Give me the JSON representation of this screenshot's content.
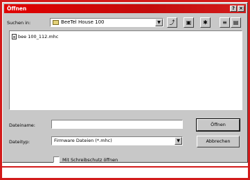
{
  "window": {
    "title": "Öffnen",
    "help_glyph": "?",
    "close_glyph": "×"
  },
  "lookin": {
    "label": "Suchen in:",
    "value": "BeeTel House 100",
    "dropdown_glyph": "▼"
  },
  "toolbar": {
    "up_glyph": "⤴",
    "desktop_glyph": "▣",
    "newfolder_glyph": "✱",
    "list_glyph": "≡",
    "details_glyph": "▤"
  },
  "files": [
    {
      "name": "bee 100_112.mhc"
    }
  ],
  "filename": {
    "label": "Dateiname:",
    "value": ""
  },
  "filetype": {
    "label": "Dateityp:",
    "value": "Firmware Dateien (*.mhc)"
  },
  "buttons": {
    "open": "Öffnen",
    "cancel": "Abbrechen"
  },
  "readonly": {
    "label": "Mit Schreibschutz öffnen",
    "checked": false
  }
}
